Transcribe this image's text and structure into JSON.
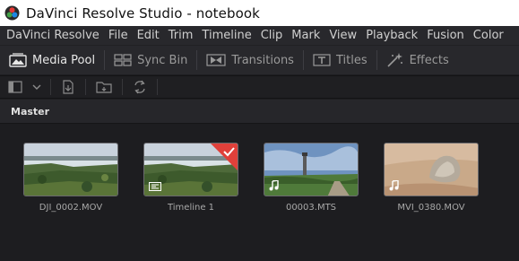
{
  "window": {
    "title": "DaVinci Resolve Studio - notebook"
  },
  "menu": [
    "DaVinci Resolve",
    "File",
    "Edit",
    "Trim",
    "Timeline",
    "Clip",
    "Mark",
    "View",
    "Playback",
    "Fusion",
    "Color"
  ],
  "toolbar": {
    "media_pool": "Media Pool",
    "sync_bin": "Sync Bin",
    "transitions": "Transitions",
    "titles": "Titles",
    "effects": "Effects"
  },
  "bin": {
    "name": "Master"
  },
  "clips": [
    {
      "name": "DJI_0002.MOV",
      "kind": "video",
      "scene": "forest-lake"
    },
    {
      "name": "Timeline 1",
      "kind": "timeline",
      "scene": "forest-lake",
      "flagged": true
    },
    {
      "name": "00003.MTS",
      "kind": "audio-video",
      "scene": "tower-meadow"
    },
    {
      "name": "MVI_0380.MOV",
      "kind": "audio-video",
      "scene": "rock-sand"
    }
  ],
  "colors": {
    "accent_flag": "#e0403a",
    "check": "#ffffff"
  },
  "icons": [
    "davinci-logo-icon",
    "media-pool-icon",
    "sync-bin-icon",
    "transitions-icon",
    "titles-icon",
    "effects-icon",
    "sidebar-toggle-icon",
    "chevron-down-icon",
    "import-media-icon",
    "new-bin-icon",
    "refresh-icon",
    "audio-note-icon",
    "timeline-icon"
  ]
}
